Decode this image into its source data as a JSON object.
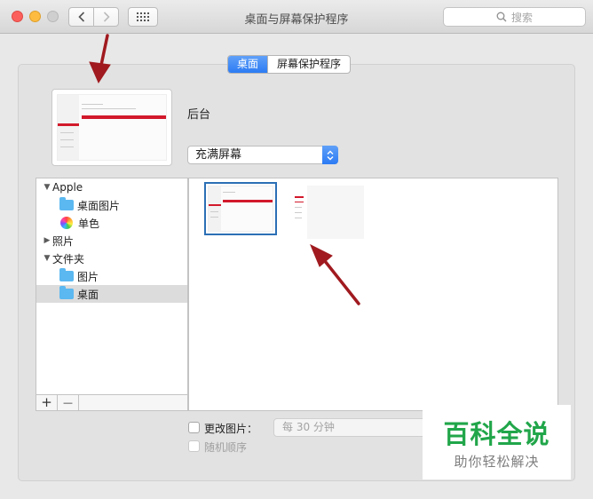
{
  "window": {
    "title": "桌面与屏幕保护程序"
  },
  "search": {
    "placeholder": "搜索"
  },
  "tabs": [
    {
      "label": "桌面",
      "active": true
    },
    {
      "label": "屏幕保护程序",
      "active": false
    }
  ],
  "background": {
    "label": "后台"
  },
  "fit": {
    "selected": "充满屏幕"
  },
  "sources": {
    "apple": "Apple",
    "desktop_pictures": "桌面图片",
    "solid_colors": "单色",
    "photos": "照片",
    "folders": "文件夹",
    "pictures": "图片",
    "desktop": "桌面",
    "add": "+",
    "remove": "—"
  },
  "options": {
    "change_picture": "更改图片：",
    "interval": "每 30 分钟",
    "random_order": "随机顺序"
  },
  "watermark": {
    "main": "百科全说",
    "sub": "助你轻松解决"
  },
  "colors": {
    "accent": "#2c7bf4",
    "annotation_arrow": "#a01a1f",
    "watermark_green": "#21a64a"
  }
}
